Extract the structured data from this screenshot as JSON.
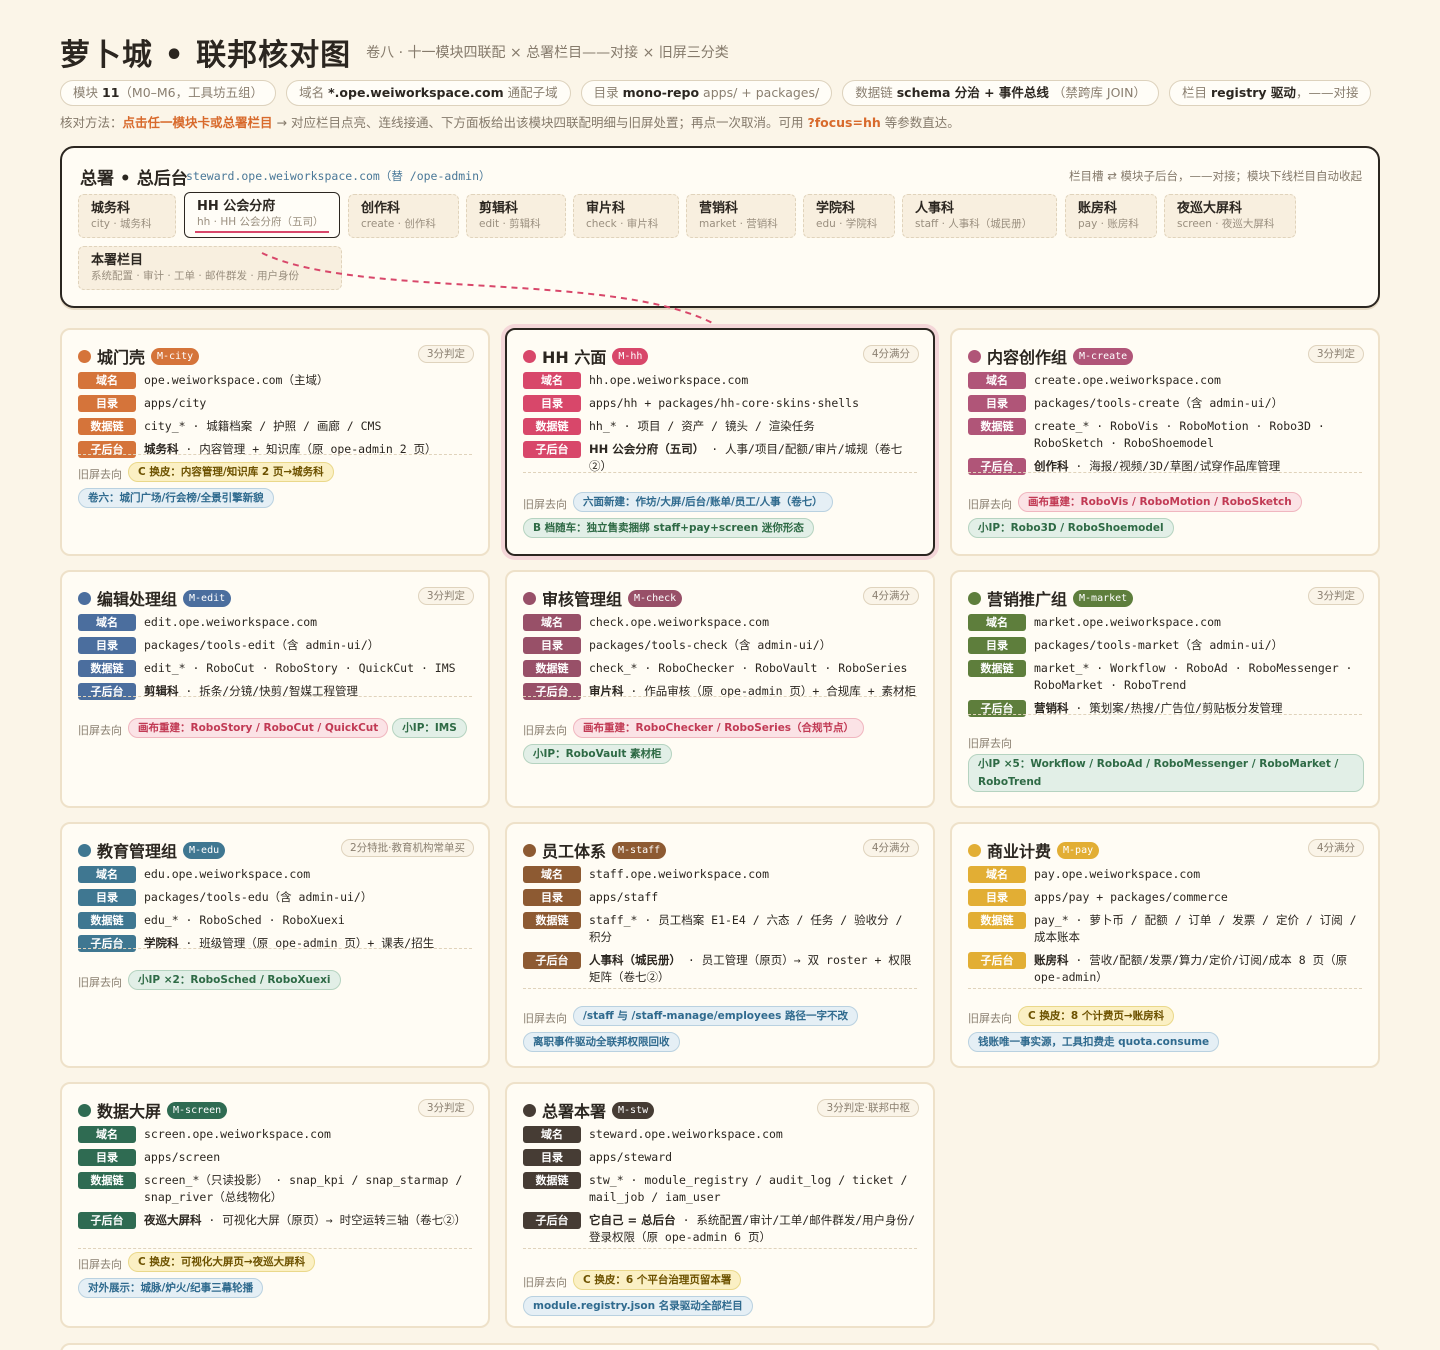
{
  "header": {
    "title": "萝卜城 • 联邦核对图",
    "subtitle": "卷八 · 十一模块四联配 × 总署栏目——对接 × 旧屏三分类"
  },
  "chips": [
    {
      "k": "模块",
      "b": "11",
      "r": "（M0–M6，工具坊五组）"
    },
    {
      "k": "域名",
      "b": "*.ope.weiworkspace.com",
      "r": "通配子域"
    },
    {
      "k": "目录",
      "b": "mono-repo",
      "r": "apps/ + packages/"
    },
    {
      "k": "数据链",
      "b": "schema 分治 + 事件总线",
      "r": "（禁跨库 JOIN）"
    },
    {
      "k": "栏目",
      "b": "registry 驱动",
      "r": "，——对接"
    }
  ],
  "method": {
    "a": "核对方法：",
    "b": "点击任一模块卡或总署栏目",
    "c": "→ 对应栏目点亮、连线接通、下方面板给出该模块四联配明细与旧屏处置；再点一次取消。可用",
    "d": "?focus=hh",
    "e": "等参数直达。"
  },
  "steward": {
    "title": "总署 • 总后台",
    "url": "steward.ope.weiworkspace.com（替 /ope-admin）",
    "note": "栏目槽 ⇄ 模块子后台，——对接；模块下线栏目自动收起",
    "columns": [
      {
        "name": "城务科",
        "sub": "city · 城务科"
      },
      {
        "name": "HH 公会分府",
        "sub": "hh · HH 公会分府（五司）"
      },
      {
        "name": "创作科",
        "sub": "create · 创作科"
      },
      {
        "name": "剪辑科",
        "sub": "edit · 剪辑科"
      },
      {
        "name": "审片科",
        "sub": "check · 审片科"
      },
      {
        "name": "营销科",
        "sub": "market · 营销科"
      },
      {
        "name": "学院科",
        "sub": "edu · 学院科"
      },
      {
        "name": "人事科",
        "sub": "staff · 人事科（城民册）"
      },
      {
        "name": "账房科",
        "sub": "pay · 账房科"
      },
      {
        "name": "夜巡大屏科",
        "sub": "screen · 夜巡大屏科"
      },
      {
        "name": "本署栏目",
        "sub": "系统配置 · 审计 · 工单 · 邮件群发 · 用户身份"
      }
    ]
  },
  "labels": {
    "domain": "域名",
    "dir": "目录",
    "data": "数据链",
    "admin": "子后台",
    "old": "旧屏去向"
  },
  "colors": {
    "city": "#d5743a",
    "hh": "#d8476a",
    "create": "#b05578",
    "edit": "#4b6e9e",
    "check": "#985068",
    "market": "#5e7e3c",
    "edu": "#3f7791",
    "staff": "#8d5a32",
    "pay": "#e2ae34",
    "screen": "#2f6b52",
    "stw": "#463c34"
  },
  "cards": [
    {
      "name": "城门壳",
      "tag": "M-city",
      "score": "3分判定",
      "domain": "ope.weiworkspace.com（主域）",
      "dir": "apps/city",
      "data": "city_* · 城籍档案 / 护照 / 画廊 / CMS",
      "admin_b": "城务科",
      "admin": " · 内容管理 + 知识库（原 ope-admin 2 页）",
      "old": [
        {
          "t": "C 换皮：内容管理/知识库 2 页→城务科",
          "c": "y"
        },
        {
          "t": "卷六：城门广场/行会榜/全景引擎新貌",
          "c": "b"
        }
      ]
    },
    {
      "name": "HH 六面",
      "tag": "M-hh",
      "score": "4分满分",
      "domain": "hh.ope.weiworkspace.com",
      "dir": "apps/hh + packages/hh-core·skins·shells",
      "data": "hh_* · 项目 / 资产 / 镜头 / 渲染任务",
      "admin_b": "HH 公会分府（五司）",
      "admin": " · 人事/项目/配额/审片/城规（卷七②）",
      "old": [
        {
          "t": "六面新建：作坊/大屏/后台/账单/员工/人事（卷七）",
          "c": "b"
        },
        {
          "t": "B 档随车：独立售卖捆绑 staff+pay+screen 迷你形态",
          "c": "g"
        }
      ]
    },
    {
      "name": "内容创作组",
      "tag": "M-create",
      "score": "3分判定",
      "domain": "create.ope.weiworkspace.com",
      "dir": "packages/tools-create（含 admin-ui/）",
      "data": "create_* · RoboVis · RoboMotion · Robo3D · RoboSketch · RoboShoemodel",
      "admin_b": "创作科",
      "admin": " · 海报/视频/3D/草图/试穿作品库管理",
      "old": [
        {
          "t": "画布重建：RoboVis / RoboMotion / RoboSketch",
          "c": "r"
        },
        {
          "t": "小IP：Robo3D / RoboShoemodel",
          "c": "g"
        }
      ]
    },
    {
      "name": "编辑处理组",
      "tag": "M-edit",
      "score": "3分判定",
      "domain": "edit.ope.weiworkspace.com",
      "dir": "packages/tools-edit（含 admin-ui/）",
      "data": "edit_* · RoboCut · RoboStory · QuickCut · IMS",
      "admin_b": "剪辑科",
      "admin": " · 拆条/分镜/快剪/智媒工程管理",
      "old": [
        {
          "t": "画布重建：RoboStory / RoboCut / QuickCut",
          "c": "r"
        },
        {
          "t": "小IP：IMS",
          "c": "g"
        }
      ]
    },
    {
      "name": "审核管理组",
      "tag": "M-check",
      "score": "4分满分",
      "domain": "check.ope.weiworkspace.com",
      "dir": "packages/tools-check（含 admin-ui/）",
      "data": "check_* · RoboChecker · RoboVault · RoboSeries",
      "admin_b": "审片科",
      "admin": " · 作品审核（原 ope-admin 页）+ 合规库 + 素材柜",
      "old": [
        {
          "t": "画布重建：RoboChecker / RoboSeries（合规节点）",
          "c": "r"
        },
        {
          "t": "小IP：RoboVault 素材柜",
          "c": "g"
        }
      ]
    },
    {
      "name": "营销推广组",
      "tag": "M-market",
      "score": "3分判定",
      "domain": "market.ope.weiworkspace.com",
      "dir": "packages/tools-market（含 admin-ui/）",
      "data": "market_* · Workflow · RoboAd · RoboMessenger · RoboMarket · RoboTrend",
      "admin_b": "营销科",
      "admin": " · 策划案/热搜/广告位/剪贴板分发管理",
      "old": [
        {
          "t": "小IP ×5：Workflow / RoboAd / RoboMessenger / RoboMarket / RoboTrend",
          "c": "g"
        }
      ]
    },
    {
      "name": "教育管理组",
      "tag": "M-edu",
      "score": "2分特批·教育机构常单买",
      "domain": "edu.ope.weiworkspace.com",
      "dir": "packages/tools-edu（含 admin-ui/）",
      "data": "edu_* · RoboSched · RoboXuexi",
      "admin_b": "学院科",
      "admin": " · 班级管理（原 ope-admin 页）+ 课表/招生",
      "old": [
        {
          "t": "小IP ×2：RoboSched / RoboXuexi",
          "c": "g"
        }
      ]
    },
    {
      "name": "员工体系",
      "tag": "M-staff",
      "score": "4分满分",
      "domain": "staff.ope.weiworkspace.com",
      "dir": "apps/staff",
      "data": "staff_* · 员工档案 E1-E4 / 六态 / 任务 / 验收分 / 积分",
      "admin_b": "人事科（城民册）",
      "admin": " · 员工管理（原页）→ 双 roster + 权限矩阵（卷七②）",
      "old": [
        {
          "t": "/staff 与 /staff-manage/employees 路径一字不改",
          "c": "b"
        },
        {
          "t": "离职事件驱动全联邦权限回收",
          "c": "b"
        }
      ]
    },
    {
      "name": "商业计费",
      "tag": "M-pay",
      "score": "4分满分",
      "domain": "pay.ope.weiworkspace.com",
      "dir": "apps/pay + packages/commerce",
      "data": "pay_* · 萝卜币 / 配额 / 订单 / 发票 / 定价 / 订阅 / 成本账本",
      "admin_b": "账房科",
      "admin": " · 营收/配额/发票/算力/定价/订阅/成本 8 页（原 ope-admin）",
      "old": [
        {
          "t": "C 换皮：8 个计费页→账房科",
          "c": "y"
        },
        {
          "t": "钱账唯一事实源，工具扣费走 quota.consume",
          "c": "b"
        }
      ]
    },
    {
      "name": "数据大屏",
      "tag": "M-screen",
      "score": "3分判定",
      "domain": "screen.ope.weiworkspace.com",
      "dir": "apps/screen",
      "data": "screen_*（只读投影） · snap_kpi / snap_starmap / snap_river（总线物化）",
      "admin_b": "夜巡大屏科",
      "admin": " · 可视化大屏（原页）→ 时空运转三轴（卷七②）",
      "old": [
        {
          "t": "C 换皮：可视化大屏页→夜巡大屏科",
          "c": "y"
        },
        {
          "t": "对外展示：城脉/炉火/纪事三幕轮播",
          "c": "b"
        }
      ]
    },
    {
      "name": "总署本署",
      "tag": "M-stw",
      "score": "3分判定·联邦中枢",
      "domain": "steward.ope.weiworkspace.com",
      "dir": "apps/steward",
      "data": "stw_* · module_registry / audit_log / ticket / mail_job / iam_user",
      "admin_b": "它自己 = 总后台",
      "admin": " · 系统配置/审计/工单/邮件群发/用户身份/登录权限（原 ope-admin 6 页）",
      "old": [
        {
          "t": "C 换皮：6 个平台治理页留本署",
          "c": "y"
        },
        {
          "t": "module.registry.json 名录驱动全部栏目",
          "c": "b"
        }
      ]
    }
  ]
}
